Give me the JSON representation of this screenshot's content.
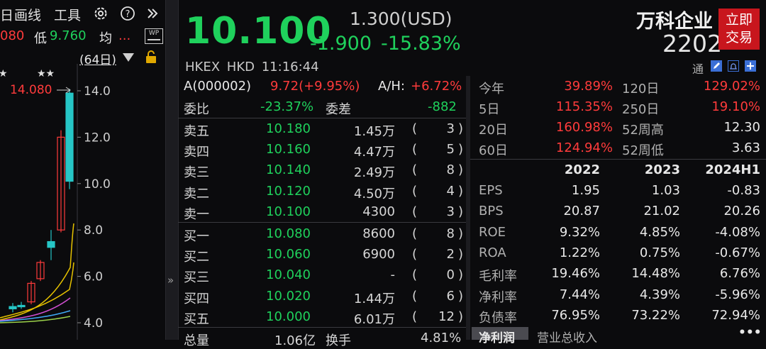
{
  "toolbar": {
    "partial_label": "日",
    "draw_label": "画线",
    "tools_label": "工具",
    "settings_icon": "gear-icon",
    "help_icon": "help-icon",
    "expand_icon": "double-chevron-right-icon"
  },
  "chart_header": {
    "high_partial": "080",
    "low_label": "低",
    "low_value": "9.760",
    "avg_label": "均",
    "avg_value": "...",
    "wp_badge": "WP",
    "period_label": "(64日)",
    "lock_icon": "unlock-icon"
  },
  "chart_data": {
    "type": "candlestick",
    "y_ticks": [
      "14.0",
      "12.0",
      "10.0",
      "8.0",
      "6.0",
      "4.0"
    ],
    "y_range": [
      4.0,
      14.0
    ],
    "marker_label": "14.080",
    "star_left": "★",
    "star_right": "★★",
    "candles": [
      {
        "open": 4.6,
        "close": 4.7,
        "high": 4.85,
        "low": 4.45,
        "up": false
      },
      {
        "open": 4.7,
        "close": 4.75,
        "high": 4.9,
        "low": 4.6,
        "up": false
      },
      {
        "open": 4.9,
        "close": 5.7,
        "high": 5.8,
        "low": 4.8,
        "up": true
      },
      {
        "open": 5.9,
        "close": 6.6,
        "high": 6.7,
        "low": 5.8,
        "up": true
      },
      {
        "open": 7.5,
        "close": 7.25,
        "high": 8.0,
        "low": 6.7,
        "up": false
      },
      {
        "open": 8.0,
        "close": 12.0,
        "high": 12.3,
        "low": 7.9,
        "up": true
      },
      {
        "open": 13.9,
        "close": 10.1,
        "high": 14.08,
        "low": 9.76,
        "up": false
      }
    ]
  },
  "header": {
    "last_price": "10.100",
    "usd_price": "1.300(USD)",
    "change": "-1.900",
    "change_pct": "-15.83%",
    "stock_name": "万科企业",
    "stock_code": "2202",
    "trade_button": "立即\n交易",
    "trade_line1": "立即",
    "trade_line2": "交易",
    "exchange": "HKEX",
    "currency": "HKD",
    "time": "11:16:44",
    "tong_label": "通"
  },
  "order_book": {
    "a_share_label": "A(000002)",
    "a_share_value": "9.72(+9.95%)",
    "ah_label": "A/H:",
    "ah_value": "+6.72%",
    "weibi_label": "委比",
    "weibi_value": "-23.37%",
    "weicha_label": "委差",
    "weicha_value": "-882",
    "asks": [
      {
        "label": "卖五",
        "price": "10.180",
        "volume": "1.45万",
        "count": "3"
      },
      {
        "label": "卖四",
        "price": "10.160",
        "volume": "4.47万",
        "count": "5"
      },
      {
        "label": "卖三",
        "price": "10.140",
        "volume": "2.49万",
        "count": "8"
      },
      {
        "label": "卖二",
        "price": "10.120",
        "volume": "4.50万",
        "count": "4"
      },
      {
        "label": "卖一",
        "price": "10.100",
        "volume": "4300",
        "count": "3"
      }
    ],
    "bids": [
      {
        "label": "买一",
        "price": "10.080",
        "volume": "8600",
        "count": "8"
      },
      {
        "label": "买二",
        "price": "10.060",
        "volume": "6900",
        "count": "2"
      },
      {
        "label": "买三",
        "price": "10.040",
        "volume": "-",
        "count": "0"
      },
      {
        "label": "买四",
        "price": "10.020",
        "volume": "1.44万",
        "count": "6"
      },
      {
        "label": "买五",
        "price": "10.000",
        "volume": "6.01万",
        "count": "12"
      }
    ],
    "total_label": "总量",
    "total_value": "1.06亿",
    "turnover_label": "换手",
    "turnover_value": "4.81%"
  },
  "stats": {
    "perf": [
      {
        "l1": "今年",
        "v1": "39.89%",
        "l2": "120日",
        "v2": "129.02%"
      },
      {
        "l1": "5日",
        "v1": "115.35%",
        "l2": "250日",
        "v2": "19.10%"
      },
      {
        "l1": "20日",
        "v1": "160.98%",
        "l2": "52周高",
        "v2": "12.30"
      },
      {
        "l1": "60日",
        "v1": "124.94%",
        "l2": "52周低",
        "v2": "3.63"
      }
    ],
    "years": [
      "2022",
      "2023",
      "2024H1"
    ],
    "fin": [
      {
        "label": "EPS",
        "v": [
          "1.95",
          "1.03",
          "-0.83"
        ]
      },
      {
        "label": "BPS",
        "v": [
          "20.87",
          "21.02",
          "20.26"
        ]
      },
      {
        "label": "ROE",
        "v": [
          "9.32%",
          "4.85%",
          "-4.08%"
        ]
      },
      {
        "label": "ROA",
        "v": [
          "1.22%",
          "0.75%",
          "-0.67%"
        ]
      },
      {
        "label": "毛利率",
        "v": [
          "19.46%",
          "14.48%",
          "6.76%"
        ]
      },
      {
        "label": "净利率",
        "v": [
          "7.44%",
          "4.39%",
          "-5.96%"
        ]
      },
      {
        "label": "负债率",
        "v": [
          "76.95%",
          "73.22%",
          "72.94%"
        ]
      }
    ],
    "tab_net_profit": "净利润",
    "tab_revenue": "营业总收入",
    "more": "•••"
  },
  "colors": {
    "up": "#ff3b3b",
    "down": "#1fd15c",
    "brand": "#c8161d",
    "candle_down": "#26c6c6"
  }
}
